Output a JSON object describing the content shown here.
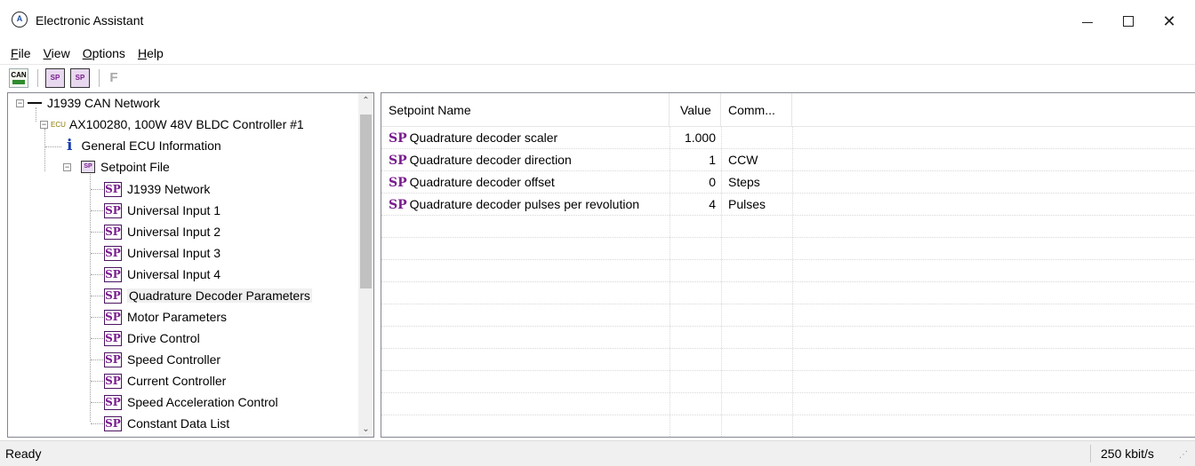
{
  "window": {
    "title": "Electronic Assistant",
    "icon": "electronic-assistant-icon",
    "controls": {
      "minimize": "minimize-icon",
      "maximize": "maximize-icon",
      "close": "✕"
    }
  },
  "menu": [
    {
      "label": "File",
      "accel": "F",
      "rest": "ile"
    },
    {
      "label": "View",
      "accel": "V",
      "rest": "iew"
    },
    {
      "label": "Options",
      "accel": "O",
      "rest": "ptions"
    },
    {
      "label": "Help",
      "accel": "H",
      "rest": "elp"
    }
  ],
  "toolbar": {
    "can_label": "CAN",
    "sp_open_label": "SP",
    "sp_save_label": "SP",
    "f_label": "F"
  },
  "tree": {
    "network": "J1939 CAN Network",
    "ecu_tag": "ECU",
    "ecu": "AX100280, 100W 48V BLDC Controller #1",
    "general_info": "General ECU Information",
    "info_glyph": "i",
    "setpoint_file": "Setpoint File",
    "spfile_glyph": "SP",
    "sp_glyph": "SP",
    "setpoint_groups": [
      "J1939 Network",
      "Universal Input 1",
      "Universal Input 2",
      "Universal Input 3",
      "Universal Input 4",
      "Quadrature Decoder Parameters",
      "Motor Parameters",
      "Drive Control",
      "Speed Controller",
      "Current Controller",
      "Speed Acceleration Control",
      "Constant Data List"
    ],
    "selected": "Quadrature Decoder Parameters"
  },
  "list": {
    "columns": [
      "Setpoint Name",
      "Value",
      "Comm..."
    ],
    "sp_glyph": "SP",
    "rows": [
      {
        "name": "Quadrature decoder scaler",
        "value": "1.000",
        "comment": ""
      },
      {
        "name": "Quadrature decoder direction",
        "value": "1",
        "comment": "CCW"
      },
      {
        "name": "Quadrature decoder offset",
        "value": "0",
        "comment": "Steps"
      },
      {
        "name": "Quadrature decoder pulses per revolution",
        "value": "4",
        "comment": "Pulses"
      }
    ]
  },
  "status": {
    "text": "Ready",
    "bitrate": "250 kbit/s"
  },
  "colors": {
    "sp_purple": "#7a1d8f",
    "info_blue": "#1a3fb0",
    "statusbar_bg": "#f0f0f0"
  }
}
